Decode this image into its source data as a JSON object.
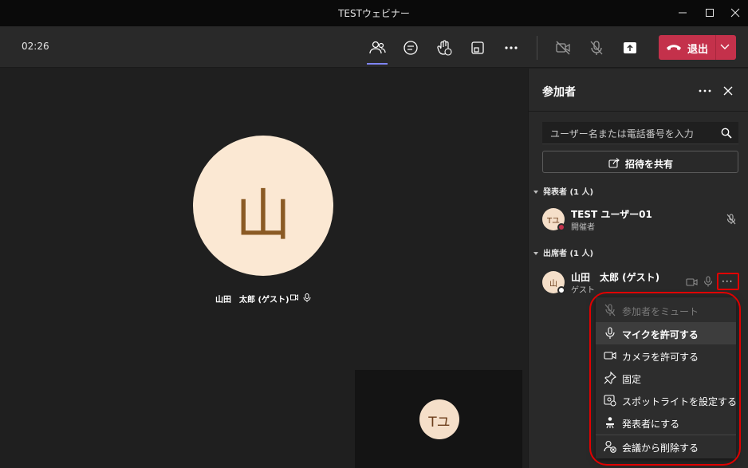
{
  "window": {
    "title": "TESTウェビナー"
  },
  "toolbar": {
    "timer": "02:26",
    "leave_label": "退出"
  },
  "stage": {
    "main_avatar_initial": "山",
    "main_name": "山田　太郎 (ゲスト)",
    "self_avatar_initials": "Tユ"
  },
  "panel": {
    "title": "参加者",
    "search_placeholder": "ユーザー名または電話番号を入力",
    "share_label": "招待を共有",
    "presenters_header": "発表者 (1 人)",
    "attendees_header": "出席者 (1 人)",
    "presenter": {
      "initials": "Tユ",
      "name": "TEST ユーザー01",
      "role": "開催者",
      "status_color": "#c4314b"
    },
    "attendee": {
      "initials": "山",
      "name": "山田　太郎 (ゲスト)",
      "role": "ゲスト",
      "status_color": "#ffffff"
    },
    "more_label": "···"
  },
  "menu": {
    "items": [
      {
        "label": "参加者をミュート",
        "icon": "mic-off-icon",
        "disabled": true
      },
      {
        "label": "マイクを許可する",
        "icon": "mic-icon",
        "hover": true
      },
      {
        "label": "カメラを許可する",
        "icon": "camera-icon"
      },
      {
        "label": "固定",
        "icon": "pin-icon"
      },
      {
        "label": "スポットライトを設定する",
        "icon": "spotlight-icon"
      },
      {
        "label": "発表者にする",
        "icon": "presenter-icon"
      },
      {
        "label": "会議から削除する",
        "icon": "remove-person-icon"
      }
    ]
  },
  "colors": {
    "accent": "#7f85f5",
    "leave": "#c4314b",
    "highlight": "#e00000"
  }
}
